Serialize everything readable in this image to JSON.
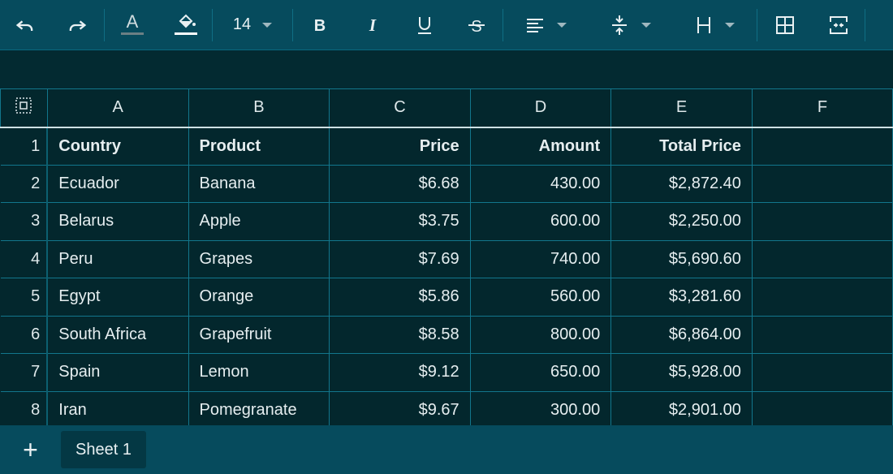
{
  "toolbar": {
    "font_size": "14",
    "icons": [
      "undo-icon",
      "redo-icon",
      "text-color-icon",
      "fill-color-icon",
      "bold-icon",
      "italic-icon",
      "underline-icon",
      "strikethrough-icon",
      "align-left-icon",
      "vertical-align-middle-icon",
      "text-wrap-icon",
      "borders-icon",
      "merge-cells-icon"
    ],
    "colors": {
      "bar": "#064b5d",
      "icon": "#e8f0f2"
    }
  },
  "grid": {
    "columns": [
      "A",
      "B",
      "C",
      "D",
      "E",
      "F"
    ],
    "rows": [
      {
        "num": "1",
        "cells": [
          "Country",
          "Product",
          "Price",
          "Amount",
          "Total Price",
          ""
        ]
      },
      {
        "num": "2",
        "cells": [
          "Ecuador",
          "Banana",
          "$6.68",
          "430.00",
          "$2,872.40",
          ""
        ]
      },
      {
        "num": "3",
        "cells": [
          "Belarus",
          "Apple",
          "$3.75",
          "600.00",
          "$2,250.00",
          ""
        ]
      },
      {
        "num": "4",
        "cells": [
          "Peru",
          "Grapes",
          "$7.69",
          "740.00",
          "$5,690.60",
          ""
        ]
      },
      {
        "num": "5",
        "cells": [
          "Egypt",
          "Orange",
          "$5.86",
          "560.00",
          "$3,281.60",
          ""
        ]
      },
      {
        "num": "6",
        "cells": [
          "South Africa",
          "Grapefruit",
          "$8.58",
          "800.00",
          "$6,864.00",
          ""
        ]
      },
      {
        "num": "7",
        "cells": [
          "Spain",
          "Lemon",
          "$9.12",
          "650.00",
          "$5,928.00",
          ""
        ]
      },
      {
        "num": "8",
        "cells": [
          "Iran",
          "Pomegranate",
          "$9.67",
          "300.00",
          "$2,901.00",
          ""
        ]
      }
    ],
    "colors": {
      "background": "#03272d",
      "border": "#12768c",
      "text": "#e6eef0"
    }
  },
  "bottom": {
    "add_label": "+",
    "sheets": [
      "Sheet 1"
    ]
  }
}
